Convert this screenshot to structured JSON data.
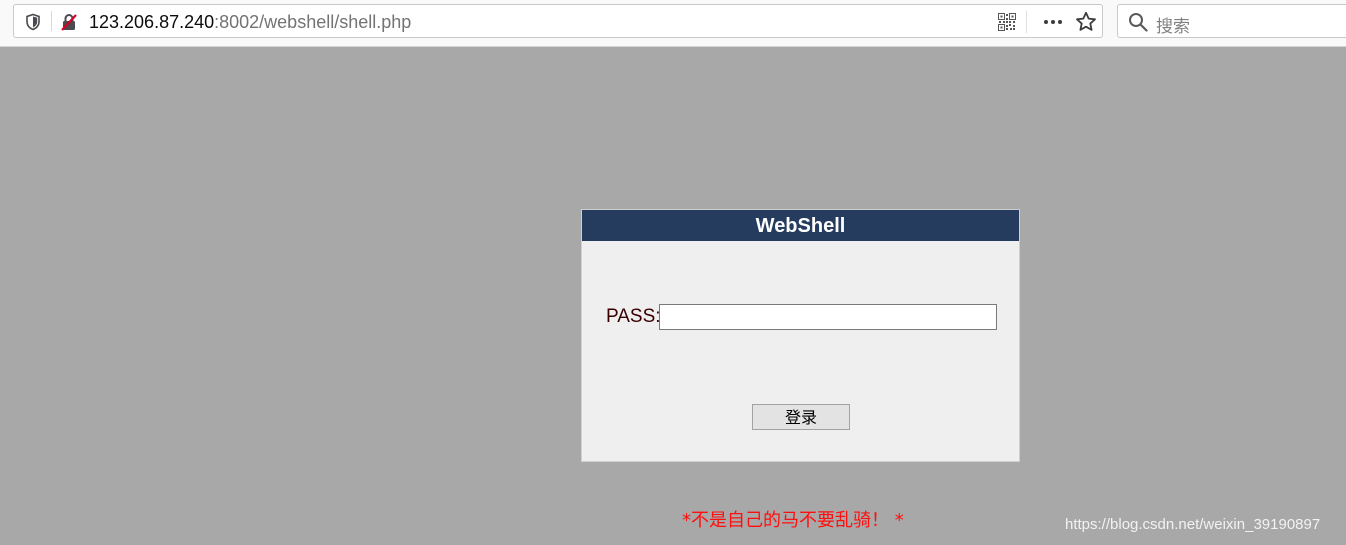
{
  "browser": {
    "url_host": "123.206.87.240",
    "url_path": ":8002/webshell/shell.php",
    "search_placeholder": "搜索",
    "icons": [
      "shield-icon",
      "insecure-lock-icon",
      "qr-code-icon",
      "more-icon",
      "star-icon",
      "search-icon"
    ]
  },
  "login": {
    "title": "WebShell",
    "pass_label": "PASS:",
    "pass_value": "",
    "submit_label": "登录"
  },
  "footer": {
    "warning": "*不是自己的马不要乱骑！ *",
    "watermark": "https://blog.csdn.net/weixin_39190897"
  },
  "colors": {
    "page_bg": "#a8a8a8",
    "header_bg": "#263c5e",
    "warning": "#ff0f0f"
  }
}
